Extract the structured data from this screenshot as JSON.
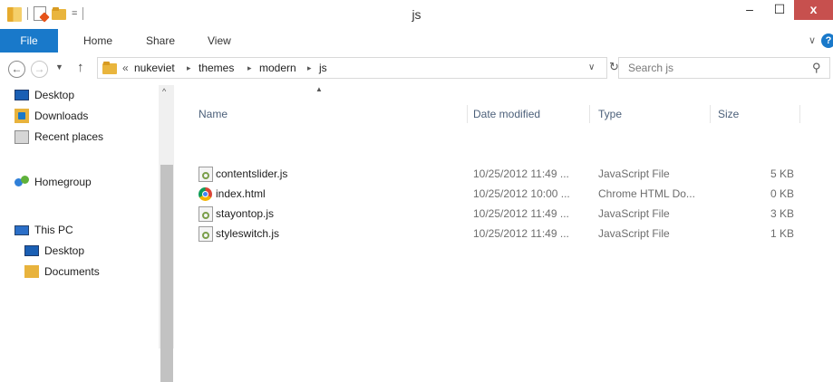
{
  "window": {
    "title": "js",
    "minimize_glyph": "–",
    "maximize_glyph": "☐",
    "close_glyph": "x",
    "qat_dropdown_glyph": "="
  },
  "ribbon": {
    "tabs": [
      {
        "label": "File"
      },
      {
        "label": "Home"
      },
      {
        "label": "Share"
      },
      {
        "label": "View"
      }
    ],
    "expand_glyph": "∨",
    "help_glyph": "?"
  },
  "address": {
    "overflow": "«",
    "separator": "▸",
    "crumbs": [
      "nukeviet",
      "themes",
      "modern",
      "js"
    ],
    "dropdown_glyph": "∨",
    "refresh_glyph": "↻"
  },
  "search": {
    "placeholder": "Search js",
    "icon": "search-icon"
  },
  "nav_pane": {
    "favorites": [
      {
        "label": "Desktop",
        "icon": "desktop-icon"
      },
      {
        "label": "Downloads",
        "icon": "downloads-icon"
      },
      {
        "label": "Recent places",
        "icon": "recent-places-icon"
      }
    ],
    "homegroup": {
      "label": "Homegroup",
      "icon": "homegroup-icon"
    },
    "this_pc": {
      "label": "This PC",
      "icon": "pc-icon"
    },
    "pc_items": [
      {
        "label": "Desktop",
        "icon": "desktop-icon"
      },
      {
        "label": "Documents",
        "icon": "documents-icon"
      }
    ]
  },
  "file_list": {
    "columns": [
      "Name",
      "Date modified",
      "Type",
      "Size"
    ],
    "sorted_by": "Name",
    "files": [
      {
        "name": "contentslider.js",
        "date": "10/25/2012 11:49 ...",
        "type": "JavaScript File",
        "size": "5 KB",
        "icon": "js-file-icon"
      },
      {
        "name": "index.html",
        "date": "10/25/2012 10:00 ...",
        "type": "Chrome HTML Do...",
        "size": "0 KB",
        "icon": "chrome-html-icon"
      },
      {
        "name": "stayontop.js",
        "date": "10/25/2012 11:49 ...",
        "type": "JavaScript File",
        "size": "3 KB",
        "icon": "js-file-icon"
      },
      {
        "name": "styleswitch.js",
        "date": "10/25/2012 11:49 ...",
        "type": "JavaScript File",
        "size": "1 KB",
        "icon": "js-file-icon"
      }
    ]
  },
  "colors": {
    "accent": "#1979ca",
    "close_button": "#c7504e",
    "header_text": "#4c607a"
  }
}
